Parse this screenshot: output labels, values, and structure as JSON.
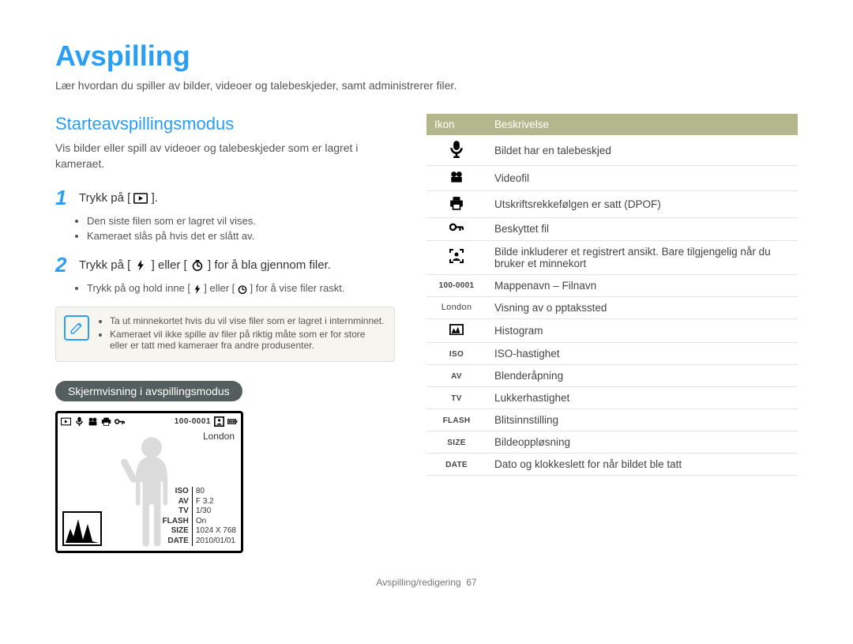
{
  "page": {
    "title": "Avspilling",
    "intro": "Lær hvordan du spiller av bilder, videoer og talebeskjeder, samt administrerer filer."
  },
  "section": {
    "title": "Starteavspillingsmodus",
    "subtitle": "Vis bilder eller spill av videoer og talebeskjeder som er lagret i kameraet."
  },
  "steps": [
    {
      "num": "1",
      "text_before": "Trykk på [",
      "text_after": "].",
      "bullets": [
        "Den siste filen som er lagret vil vises.",
        "Kameraet slås på hvis det er slått av."
      ]
    },
    {
      "num": "2",
      "text_before": "Trykk på [",
      "mid": "] eller [",
      "text_after": "] for å bla gjennom filer.",
      "bullets": [
        "Trykk på og hold inne [  ] eller [  ] for å vise filer raskt."
      ]
    }
  ],
  "note": {
    "items": [
      "Ta ut minnekortet hvis du vil vise filer som er lagret i internminnet.",
      "Kameraet vil ikke spille av filer på riktig måte som er for store eller er tatt med kameraer fra andre produsenter."
    ]
  },
  "pill": "Skjermvisning i avspillingsmodus",
  "preview": {
    "file_id": "100-0001",
    "location": "London",
    "info": {
      "ISO": "80",
      "AV": "F 3.2",
      "TV": "1/30",
      "FLASH": "On",
      "SIZE": "1024 X 768",
      "DATE": "2010/01/01"
    }
  },
  "table": {
    "headers": [
      "Ikon",
      "Beskrivelse"
    ],
    "rows": [
      {
        "icon": "mic",
        "desc": "Bildet har en talebeskjed"
      },
      {
        "icon": "movie",
        "desc": "Videofil"
      },
      {
        "icon": "print",
        "desc": "Utskriftsrekkefølgen er satt (DPOF)"
      },
      {
        "icon": "key",
        "desc": "Beskyttet fil"
      },
      {
        "icon": "face",
        "desc": "Bilde inkluderer et registrert ansikt. Bare tilgjengelig når du bruker et minnekort"
      },
      {
        "icon_text": "100-0001",
        "desc": "Mappenavn – Filnavn"
      },
      {
        "icon_text": "London",
        "desc": "Visning av o pptakssted"
      },
      {
        "icon": "histogram",
        "desc": "Histogram"
      },
      {
        "icon_text": "ISO",
        "desc": "ISO-hastighet"
      },
      {
        "icon_text": "AV",
        "desc": "Blenderåpning"
      },
      {
        "icon_text": "TV",
        "desc": "Lukkerhastighet"
      },
      {
        "icon_text": "FLASH",
        "desc": "Blitsinnstilling"
      },
      {
        "icon_text": "SIZE",
        "desc": "Bildeoppløsning"
      },
      {
        "icon_text": "DATE",
        "desc": "Dato og klokkeslett for når bildet ble tatt"
      }
    ]
  },
  "footer": {
    "label": "Avspilling/redigering",
    "page": "67"
  }
}
